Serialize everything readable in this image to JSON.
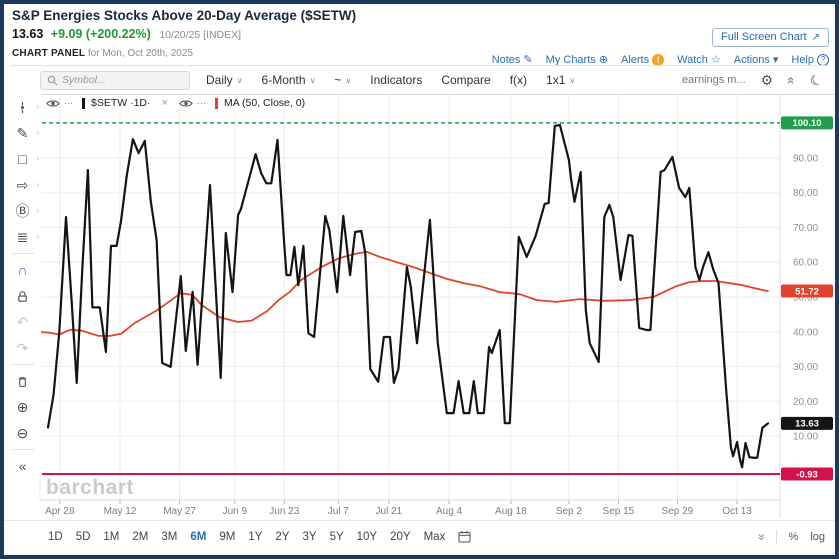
{
  "header": {
    "title": "S&P Energies Stocks Above 20-Day Average ($SETW)",
    "price": "13.63",
    "change": "+9.09 (+200.22%)",
    "date_info": "10/20/25 [INDEX]",
    "panel_label": "CHART PANEL",
    "panel_date": "for Mon, Oct 20th, 2025",
    "fullscreen_button": "Full Screen Chart",
    "links": [
      {
        "name": "notes",
        "label": "Notes",
        "icon": "notes-icon"
      },
      {
        "name": "my-charts",
        "label": "My Charts",
        "icon": "add-circle-icon"
      },
      {
        "name": "alerts",
        "label": "Alerts",
        "icon": "alert-badge-icon"
      },
      {
        "name": "watch",
        "label": "Watch",
        "icon": "star-icon"
      },
      {
        "name": "actions",
        "label": "Actions",
        "icon": "caret-down-icon"
      },
      {
        "name": "help",
        "label": "Help",
        "icon": "help-circle-icon"
      }
    ]
  },
  "toolbar": {
    "symbol_placeholder": "Symbol...",
    "items": [
      {
        "name": "frequency",
        "label": "Daily",
        "caret": true
      },
      {
        "name": "range",
        "label": "6-Month",
        "caret": true
      },
      {
        "name": "line-type",
        "label": "~",
        "caret": true
      },
      {
        "name": "indicators",
        "label": "Indicators",
        "caret": false
      },
      {
        "name": "compare",
        "label": "Compare",
        "caret": false
      },
      {
        "name": "fx",
        "label": "f(x)",
        "caret": false
      },
      {
        "name": "grid-layout",
        "label": "1x1",
        "caret": true
      }
    ],
    "earnings_label": "earnings m..."
  },
  "drawing_toolbar": [
    {
      "name": "cursor-tool",
      "submenu": true
    },
    {
      "name": "trendline-tools",
      "submenu": true
    },
    {
      "name": "shapes-tool",
      "submenu": true
    },
    {
      "name": "arrow-tool",
      "submenu": true
    },
    {
      "name": "brush-tool",
      "submenu": true
    },
    {
      "name": "settings-tool",
      "submenu": true
    },
    "sep",
    {
      "name": "magnet-tool"
    },
    {
      "name": "lock-tool"
    },
    {
      "name": "undo-button",
      "disabled": true
    },
    {
      "name": "redo-button",
      "disabled": true
    },
    "sep",
    {
      "name": "trash-tool"
    },
    {
      "name": "zoom-in-tool"
    },
    {
      "name": "zoom-out-tool"
    },
    "sep",
    {
      "name": "collapse-panel-button"
    }
  ],
  "watermark": "barchart",
  "bottombar": {
    "ranges": [
      "1D",
      "5D",
      "1M",
      "2M",
      "3M",
      "6M",
      "9M",
      "1Y",
      "2Y",
      "3Y",
      "5Y",
      "10Y",
      "20Y",
      "Max"
    ],
    "active_range": "6M",
    "percent_label": "%",
    "log_label": "log"
  },
  "colors": {
    "link_blue": "#2e6cb5",
    "change_green": "#1f9a33",
    "page_border": "#1c3a5f",
    "grid": "#ededed",
    "axis_label": "#8f8f8f"
  },
  "chart_data": {
    "type": "line",
    "title": "S&P Energies Stocks Above 20-Day Average ($SETW)",
    "x_axis": {
      "range_days": [
        0,
        128
      ],
      "ticks": [
        {
          "label": "Apr 28",
          "day": 2.1
        },
        {
          "label": "May 12",
          "day": 12.8
        },
        {
          "label": "May 27",
          "day": 23.4
        },
        {
          "label": "Jun 9",
          "day": 33.2
        },
        {
          "label": "Jun 23",
          "day": 42.0
        },
        {
          "label": "Jul 7",
          "day": 51.6
        },
        {
          "label": "Jul 21",
          "day": 60.6
        },
        {
          "label": "Aug 4",
          "day": 71.3
        },
        {
          "label": "Aug 18",
          "day": 82.3
        },
        {
          "label": "Sep 2",
          "day": 92.6
        },
        {
          "label": "Sep 15",
          "day": 101.4
        },
        {
          "label": "Sep 29",
          "day": 111.9
        },
        {
          "label": "Oct 13",
          "day": 122.5
        }
      ]
    },
    "y_axis": {
      "ticks": [
        10,
        20,
        30,
        40,
        50,
        60,
        70,
        80,
        90
      ],
      "ylim": [
        -8.4,
        108.4
      ]
    },
    "grid": true,
    "hlines": [
      {
        "name": "period-high-line",
        "value": 100.1,
        "label": "100.10",
        "color": "#1f9e4b",
        "style": "dashed"
      },
      {
        "name": "period-low-line",
        "value": -0.93,
        "label": "-0.93",
        "color": "#d4114d",
        "style": "solid"
      }
    ],
    "series": [
      {
        "name": "MA(50)",
        "legend": "MA (50, Close, 0)",
        "color": "#e0432d",
        "width": 1.8,
        "last_label": "51.72",
        "points": [
          [
            -1.5,
            39.9
          ],
          [
            0,
            39.8
          ],
          [
            2,
            39.2
          ],
          [
            4,
            40.6
          ],
          [
            6,
            40.3
          ],
          [
            9,
            38.8
          ],
          [
            11,
            38.8
          ],
          [
            13,
            39.4
          ],
          [
            15.4,
            42.5
          ],
          [
            19.5,
            46.3
          ],
          [
            23.6,
            51.1
          ],
          [
            25.7,
            50.6
          ],
          [
            27.3,
            47.7
          ],
          [
            30.5,
            44.2
          ],
          [
            33.8,
            42.8
          ],
          [
            36.2,
            43.2
          ],
          [
            39,
            46
          ],
          [
            41,
            49.1
          ],
          [
            43,
            51.5
          ],
          [
            45,
            54.9
          ],
          [
            48.6,
            58.6
          ],
          [
            51.8,
            61.2
          ],
          [
            54.6,
            62.4
          ],
          [
            56.7,
            63
          ],
          [
            59,
            61.5
          ],
          [
            62,
            60
          ],
          [
            65,
            58.6
          ],
          [
            67.9,
            56.9
          ],
          [
            70.9,
            55.2
          ],
          [
            73.9,
            54
          ],
          [
            76.8,
            53.1
          ],
          [
            80.3,
            51.4
          ],
          [
            83.9,
            50.8
          ],
          [
            86.9,
            49.1
          ],
          [
            90.4,
            48.6
          ],
          [
            94.5,
            49.4
          ],
          [
            98.8,
            48.9
          ],
          [
            103.4,
            49.1
          ],
          [
            107.6,
            50
          ],
          [
            111.7,
            53.1
          ],
          [
            114,
            54.3
          ],
          [
            116.5,
            54.6
          ],
          [
            118.8,
            54.6
          ],
          [
            120,
            54.3
          ],
          [
            123.5,
            53.4
          ],
          [
            127,
            52
          ],
          [
            128,
            51.72
          ]
        ]
      },
      {
        "name": "$SETW",
        "legend": "$SETW ·1D·",
        "color": "#141414",
        "width": 2.2,
        "last_label": "13.63",
        "points": [
          [
            0,
            12.5
          ],
          [
            1,
            22
          ],
          [
            2,
            40
          ],
          [
            3.2,
            73
          ],
          [
            4.2,
            49
          ],
          [
            5.1,
            25.3
          ],
          [
            6.1,
            58
          ],
          [
            7.1,
            86.5
          ],
          [
            7.9,
            47
          ],
          [
            9.2,
            47
          ],
          [
            10.3,
            34.2
          ],
          [
            11.2,
            64.7
          ],
          [
            12.2,
            64.7
          ],
          [
            13,
            72
          ],
          [
            14,
            85
          ],
          [
            15.1,
            95.4
          ],
          [
            16.1,
            91.4
          ],
          [
            17.2,
            94.9
          ],
          [
            18.3,
            77.3
          ],
          [
            19.3,
            66.4
          ],
          [
            20.3,
            31
          ],
          [
            21.8,
            29.9
          ],
          [
            23.6,
            56
          ],
          [
            24.5,
            34.5
          ],
          [
            25.7,
            51.5
          ],
          [
            26.6,
            30.5
          ],
          [
            28.8,
            82.2
          ],
          [
            30.7,
            26.7
          ],
          [
            31.6,
            68.4
          ],
          [
            32.8,
            51.4
          ],
          [
            33.8,
            73.6
          ],
          [
            34.3,
            75.3
          ],
          [
            36.9,
            91.1
          ],
          [
            37.9,
            85.6
          ],
          [
            38.8,
            82.7
          ],
          [
            39.7,
            82.7
          ],
          [
            40.8,
            95.2
          ],
          [
            42,
            64.9
          ],
          [
            42.4,
            56.3
          ],
          [
            43.1,
            56.3
          ],
          [
            43.8,
            64.4
          ],
          [
            44.5,
            53.4
          ],
          [
            45.4,
            64.7
          ],
          [
            46.3,
            39.6
          ],
          [
            47.3,
            38.5
          ],
          [
            49.3,
            73.3
          ],
          [
            50,
            69.3
          ],
          [
            51.4,
            51.4
          ],
          [
            52.5,
            73.3
          ],
          [
            53.7,
            56.3
          ],
          [
            54.6,
            68.7
          ],
          [
            55.7,
            69
          ],
          [
            56.4,
            62.6
          ],
          [
            57.3,
            29.3
          ],
          [
            58.7,
            25.6
          ],
          [
            59.7,
            38.5
          ],
          [
            60.8,
            38.5
          ],
          [
            61.5,
            25.3
          ],
          [
            62.3,
            29.3
          ],
          [
            63.8,
            58.6
          ],
          [
            64.5,
            52.9
          ],
          [
            65.6,
            36.7
          ],
          [
            67.9,
            72.2
          ],
          [
            69.3,
            36.7
          ],
          [
            70.9,
            16.6
          ],
          [
            72.1,
            16.6
          ],
          [
            73,
            25.8
          ],
          [
            73.9,
            16.6
          ],
          [
            74.9,
            16.6
          ],
          [
            75.7,
            25.8
          ],
          [
            76.4,
            16.6
          ],
          [
            77.5,
            16.6
          ],
          [
            78.4,
            35.6
          ],
          [
            78.9,
            33.9
          ],
          [
            80.3,
            40.5
          ],
          [
            81.2,
            13.7
          ],
          [
            82.1,
            13.7
          ],
          [
            83.7,
            67.3
          ],
          [
            85.1,
            61.5
          ],
          [
            86.7,
            67.6
          ],
          [
            88.3,
            76.8
          ],
          [
            89,
            77
          ],
          [
            90.1,
            99.2
          ],
          [
            91,
            99.5
          ],
          [
            92.6,
            89.4
          ],
          [
            93,
            83.9
          ],
          [
            93.6,
            77.4
          ],
          [
            94.7,
            86
          ],
          [
            95.6,
            46.3
          ],
          [
            96.3,
            36.7
          ],
          [
            97.9,
            31.3
          ],
          [
            98.9,
            73
          ],
          [
            99.8,
            76.5
          ],
          [
            100.5,
            73
          ],
          [
            101.8,
            54.9
          ],
          [
            103.2,
            67.8
          ],
          [
            103.9,
            67.6
          ],
          [
            105.1,
            41.1
          ],
          [
            106.4,
            40.5
          ],
          [
            107.1,
            40.5
          ],
          [
            108.9,
            86
          ],
          [
            109.6,
            86.5
          ],
          [
            111,
            90.3
          ],
          [
            112.2,
            81.4
          ],
          [
            113.3,
            78.7
          ],
          [
            114,
            81.4
          ],
          [
            115.1,
            58.6
          ],
          [
            115.8,
            54.9
          ],
          [
            116.5,
            58.9
          ],
          [
            117.4,
            62.9
          ],
          [
            118.3,
            57.8
          ],
          [
            119.2,
            54
          ],
          [
            120.6,
            22.4
          ],
          [
            121.4,
            6.8
          ],
          [
            121.8,
            4.2
          ],
          [
            122.5,
            8.3
          ],
          [
            123,
            3.4
          ],
          [
            123.4,
            1
          ],
          [
            124,
            8
          ],
          [
            124.7,
            3.9
          ],
          [
            125.6,
            3.7
          ],
          [
            126.1,
            3.8
          ],
          [
            127,
            12.4
          ],
          [
            128,
            13.63
          ]
        ]
      }
    ]
  }
}
